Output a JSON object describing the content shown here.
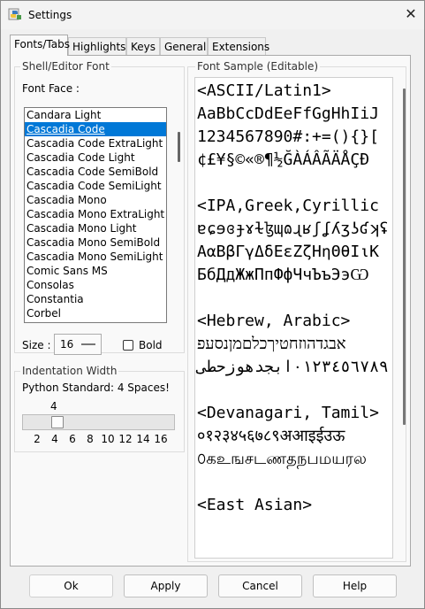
{
  "window": {
    "title": "Settings",
    "close_glyph": "✕"
  },
  "tabs": [
    {
      "label": "Fonts/Tabs",
      "active": true
    },
    {
      "label": "Highlights"
    },
    {
      "label": "Keys"
    },
    {
      "label": "General"
    },
    {
      "label": "Extensions"
    }
  ],
  "shell_font": {
    "group_label": "Shell/Editor Font",
    "font_face_label": "Font Face :",
    "fonts": [
      "Candara Light",
      "Cascadia Code",
      "Cascadia Code ExtraLight",
      "Cascadia Code Light",
      "Cascadia Code SemiBold",
      "Cascadia Code SemiLight",
      "Cascadia Mono",
      "Cascadia Mono ExtraLight",
      "Cascadia Mono Light",
      "Cascadia Mono SemiBold",
      "Cascadia Mono SemiLight",
      "Comic Sans MS",
      "Consolas",
      "Constantia",
      "Corbel"
    ],
    "selected_font": "Cascadia Code",
    "size_label": "Size :",
    "size_value": "16",
    "bold_label": "Bold",
    "bold_checked": false
  },
  "indentation": {
    "group_label": "Indentation Width",
    "description": "Python Standard: 4 Spaces!",
    "value_display": "4",
    "value": 4,
    "min": 2,
    "max": 16,
    "ticks": [
      "2",
      "4",
      "6",
      "8",
      "10",
      "12",
      "14",
      "16"
    ]
  },
  "sample": {
    "group_label": "Font Sample (Editable)",
    "lines": [
      "<ASCII/Latin1>",
      "AaBbCcDdEeFfGgHhIiJ",
      "1234567890#:+=(){}[",
      "¢£¥§©«®¶½ĞÀÁÂÃÄÅÇÐ",
      "",
      "<IPA,Greek,Cyrillic",
      "ɐɕɘɞɟɤɫɮɰɷɻʁʃʆʎʒʖʛʞʢ",
      "ΑαΒβΓγΔδΕεΖζΗηΘθΙιΚ",
      "БбДдЖжПпФфЧчЪъЭэѠ",
      "",
      "<Hebrew, Arabic>",
      "אבגדהוזחטיךכלםמןנסעפ",
      "٠١٢٣٤٥٦٧٨٩ابجدهوزحطى",
      "",
      "<Devanagari, Tamil>",
      "०१२३४५६७८९अआइईउऊ",
      "௦கஉஙசடணதநபமயரல",
      "",
      "<East Asian>"
    ]
  },
  "buttons": {
    "ok": "Ok",
    "apply": "Apply",
    "cancel": "Cancel",
    "help": "Help"
  }
}
